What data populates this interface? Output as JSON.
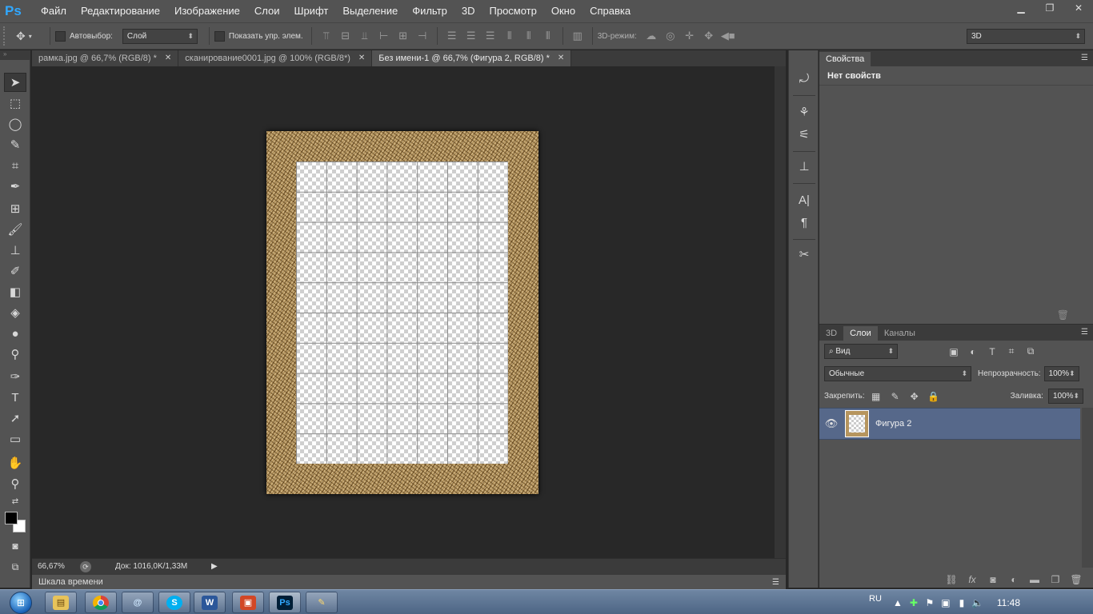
{
  "app": {
    "logo": "Ps",
    "menu": [
      "Файл",
      "Редактирование",
      "Изображение",
      "Слои",
      "Шрифт",
      "Выделение",
      "Фильтр",
      "3D",
      "Просмотр",
      "Окно",
      "Справка"
    ],
    "window_controls": [
      "minimize-icon",
      "restore-icon",
      "close-icon"
    ]
  },
  "options_bar": {
    "tool_icon": "move-tool-icon",
    "autoselect_label": "Автовыбор:",
    "autoselect_checked": false,
    "autoselect_target": "Слой",
    "show_transform_label": "Показать упр. элем.",
    "show_transform_checked": false,
    "mode_3d_label": "3D-режим:",
    "workspace": "3D"
  },
  "tabs": [
    {
      "label": "рамка.jpg @ 66,7% (RGB/8) *",
      "active": false
    },
    {
      "label": "сканирование0001.jpg @ 100% (RGB/8*)",
      "active": false
    },
    {
      "label": "Без имени-1 @ 66,7% (Фигура 2, RGB/8) *",
      "active": true
    }
  ],
  "tools": [
    "move-icon",
    "marquee-icon",
    "lasso-icon",
    "quick-select-icon",
    "crop-icon",
    "eyedropper-icon",
    "healing-brush-icon",
    "brush-icon",
    "clone-stamp-icon",
    "history-brush-icon",
    "eraser-icon",
    "paint-bucket-icon",
    "blur-icon",
    "dodge-icon",
    "pen-icon",
    "type-icon",
    "path-select-icon",
    "rectangle-icon",
    "hand-icon",
    "zoom-icon"
  ],
  "status": {
    "zoom": "66,67%",
    "doc_info": "Док: 1016,0K/1,33M"
  },
  "timeline": {
    "label": "Шкала времени"
  },
  "colors": {
    "foreground": "#000000",
    "background": "#ffffff",
    "selected_layer": "#56688a",
    "frame": "#b6955e"
  },
  "properties_panel": {
    "tab": "Свойства",
    "title": "Нет свойств"
  },
  "layers_panel": {
    "tabs": [
      "3D",
      "Слои",
      "Каналы"
    ],
    "active_tab": "Слои",
    "filter_label": "Вид",
    "blend_mode": "Обычные",
    "opacity_label": "Непрозрачность:",
    "opacity_value": "100%",
    "lock_label": "Закрепить:",
    "fill_label": "Заливка:",
    "fill_value": "100%",
    "layers": [
      {
        "name": "Фигура 2",
        "visible": true,
        "selected": true
      }
    ]
  },
  "taskbar": {
    "apps": [
      "explorer-icon",
      "chrome-icon",
      "mail-icon",
      "skype-icon",
      "word-icon",
      "powerpoint-icon",
      "photoshop-icon",
      "paint-icon"
    ],
    "lang": "RU",
    "time": "11:48"
  }
}
